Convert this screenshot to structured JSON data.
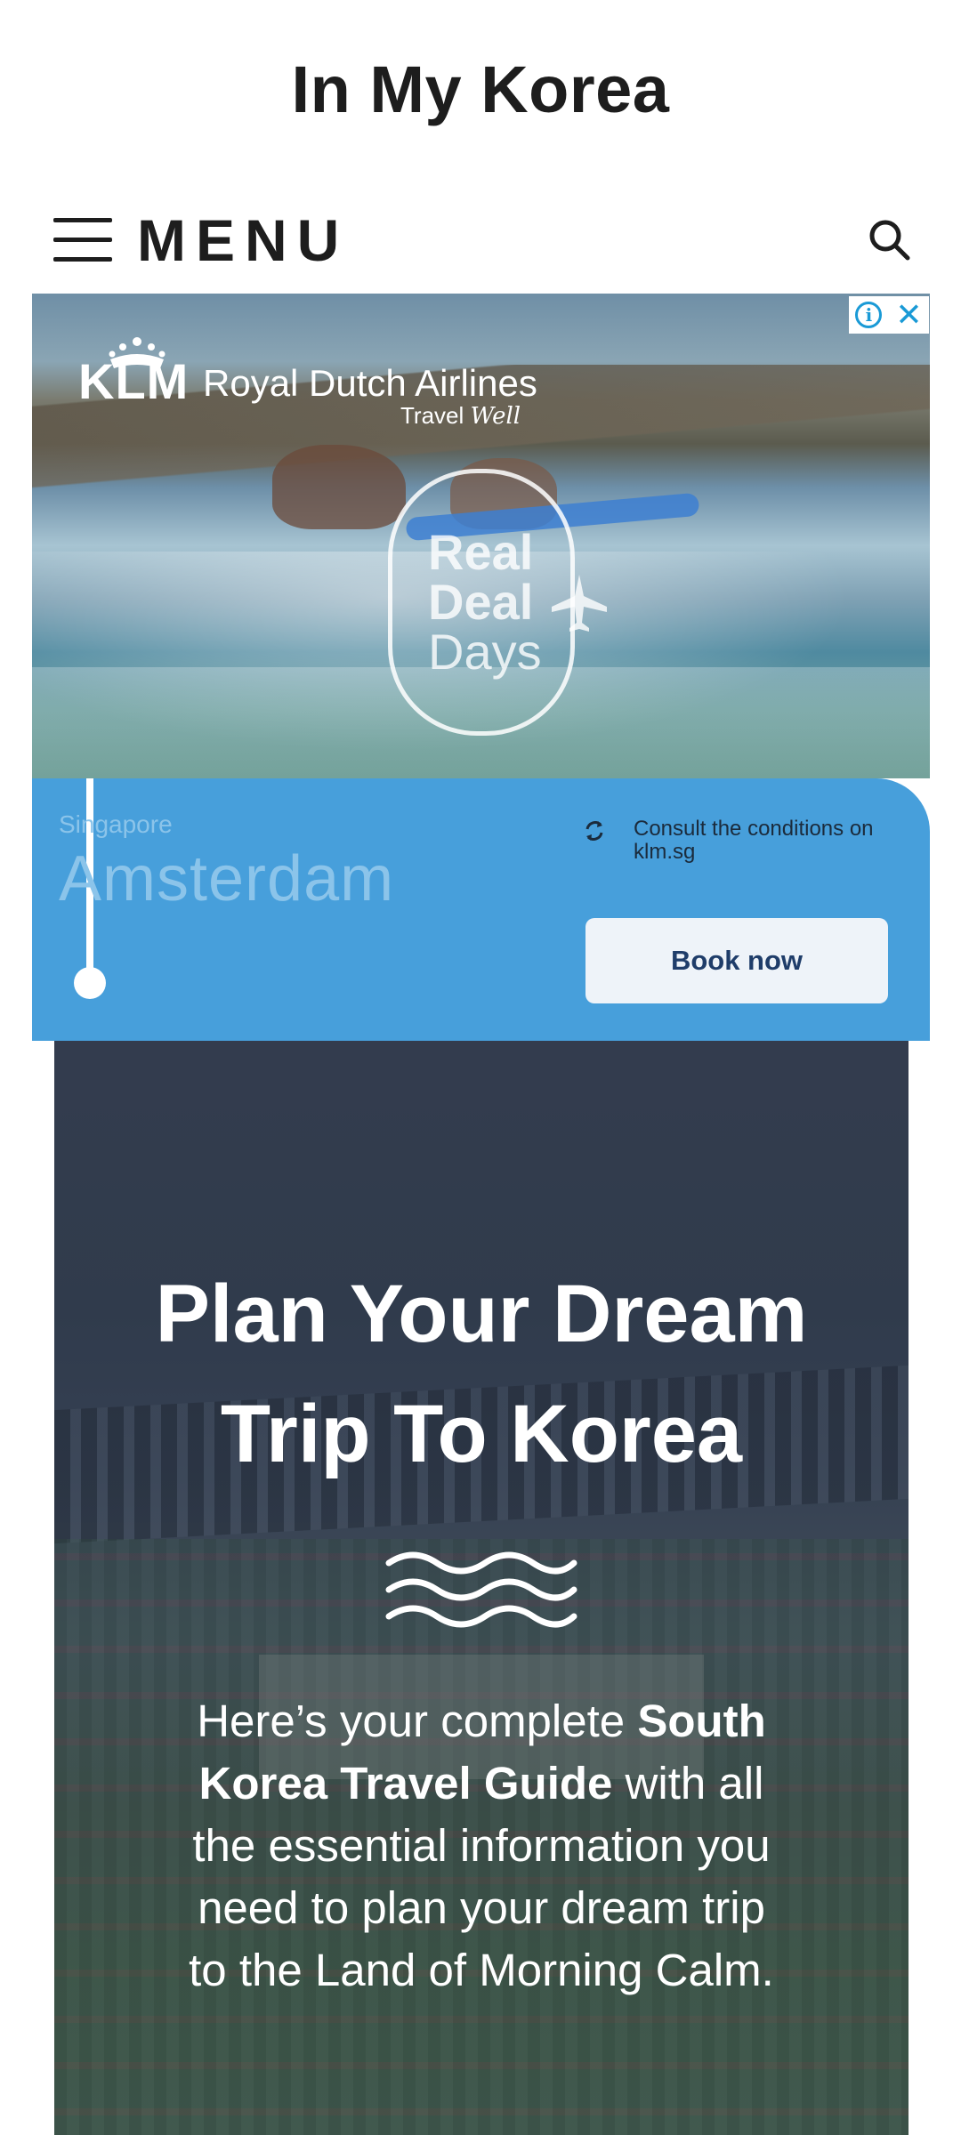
{
  "header": {
    "site_title": "In My Korea",
    "menu_label": "MENU"
  },
  "ad": {
    "brand_mark": "KLM",
    "brand_name": "Royal Dutch Airlines",
    "tagline_main": "Travel ",
    "tagline_em": "Well",
    "promo_lines": [
      "Real",
      "Deal",
      "Days"
    ],
    "origin": "Singapore",
    "destination": "Amsterdam",
    "conditions": "Consult the conditions on klm.sg",
    "cta": "Book now",
    "colors": {
      "panel": "#479fdb",
      "adchoices": "#1a9ad6"
    }
  },
  "hero": {
    "title_line1": "Plan Your Dream",
    "title_line2": "Trip To Korea",
    "text_intro": "Here’s your complete ",
    "text_bold": "South Korea Travel Guide",
    "text_rest": " with all the essential information you need to plan your dream trip to the Land of Morning Calm."
  }
}
